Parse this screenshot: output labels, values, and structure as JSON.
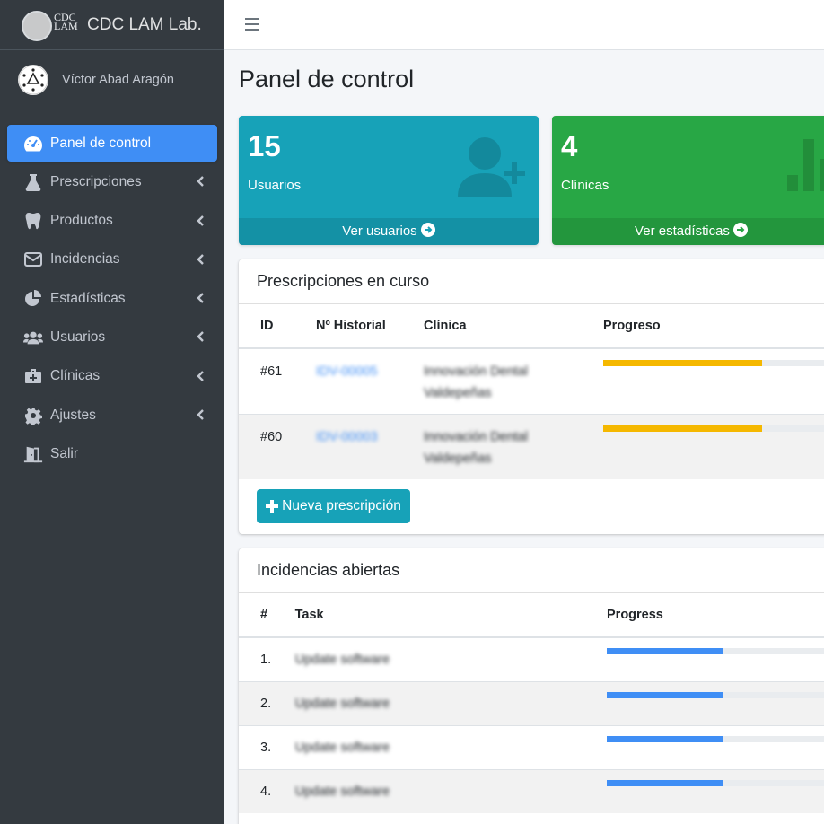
{
  "brand": {
    "logo_text_top": "CDC",
    "logo_text_bottom": "LAM",
    "name": "CDC LAM Lab."
  },
  "user": {
    "name": "Víctor Abad Aragón"
  },
  "sidebar": {
    "items": [
      {
        "label": "Panel de control",
        "icon": "tachometer-icon",
        "active": true
      },
      {
        "label": "Prescripciones",
        "icon": "flask-icon"
      },
      {
        "label": "Productos",
        "icon": "tooth-icon"
      },
      {
        "label": "Incidencias",
        "icon": "envelope-icon"
      },
      {
        "label": "Estadísticas",
        "icon": "pie-chart-icon"
      },
      {
        "label": "Usuarios",
        "icon": "users-icon"
      },
      {
        "label": "Clínicas",
        "icon": "medkit-icon"
      },
      {
        "label": "Ajustes",
        "icon": "gear-icon"
      },
      {
        "label": "Salir",
        "icon": "door-exit-icon"
      }
    ]
  },
  "page": {
    "title": "Panel de control"
  },
  "boxes": [
    {
      "number": "15",
      "label": "Usuarios",
      "link": "Ver usuarios",
      "color": "#17a2b8",
      "icon": "user-plus-icon"
    },
    {
      "number": "4",
      "label": "Clínicas",
      "link": "Ver estadísticas",
      "color": "#28a745",
      "icon": "bar-chart-icon"
    }
  ],
  "prescriptions": {
    "title": "Prescripciones en curso",
    "columns": [
      "ID",
      "Nº Historial",
      "Clínica",
      "Progreso"
    ],
    "rows": [
      {
        "id": "#61",
        "historial": "IDV-00005",
        "clinica_1": "Innovación Dental",
        "clinica_2": "Valdepeñas",
        "progress": 0.68
      },
      {
        "id": "#60",
        "historial": "IDV-00003",
        "clinica_1": "Innovación Dental",
        "clinica_2": "Valdepeñas",
        "progress": 0.68
      }
    ],
    "new_button": "Nueva prescripción",
    "progress_color": "#f5b800"
  },
  "incidences": {
    "title": "Incidencias abiertas",
    "columns": [
      "#",
      "Task",
      "Progress"
    ],
    "rows": [
      {
        "n": "1.",
        "task": "Update software",
        "progress": 0.5
      },
      {
        "n": "2.",
        "task": "Update software",
        "progress": 0.5
      },
      {
        "n": "3.",
        "task": "Update software",
        "progress": 0.5
      },
      {
        "n": "4.",
        "task": "Update software",
        "progress": 0.5
      }
    ],
    "progress_color": "#3f8ef5"
  }
}
